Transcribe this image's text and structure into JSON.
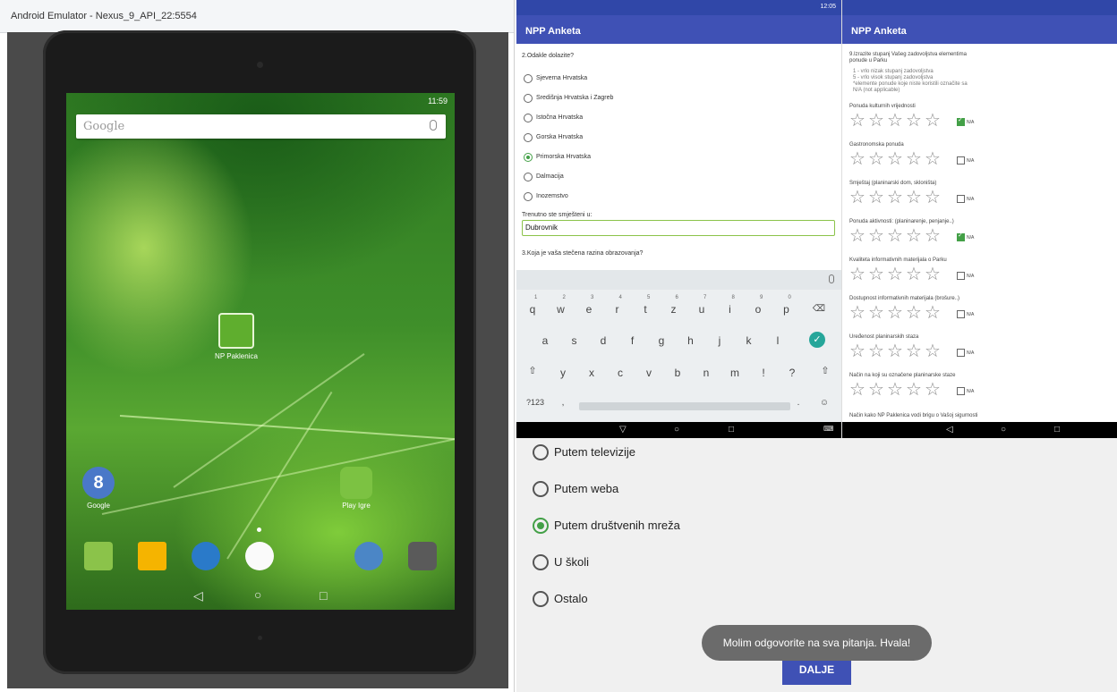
{
  "emulator": {
    "window_title": "Android Emulator - Nexus_9_API_22:5554",
    "status_time": "11:59",
    "search_label": "Google",
    "center_app": "NP Paklenica",
    "left_app": "Google",
    "right_app": "Play Igre"
  },
  "phone1": {
    "status_time": "12:05",
    "title": "NPP Anketa",
    "question": "2.Odakle dolazite?",
    "options": [
      "Sjeverna Hrvatska",
      "Središnja Hrvatska i Zagreb",
      "Istočna Hrvatska",
      "Gorska Hrvatska",
      "Primorska Hrvatska",
      "Dalmacija",
      "Inozemstvo"
    ],
    "selected_option": "Primorska Hrvatska",
    "stay_label": "Trenutno ste smješteni u:",
    "stay_value": "Dubrovnik",
    "question3": "3.Koja je vaša stečena razina obrazovanja?",
    "keyboard": {
      "row1": [
        "q",
        "w",
        "e",
        "r",
        "t",
        "z",
        "u",
        "i",
        "o",
        "p"
      ],
      "row1_hints": [
        "1",
        "2",
        "3",
        "4",
        "5",
        "6",
        "7",
        "8",
        "9",
        "0"
      ],
      "row2": [
        "a",
        "s",
        "d",
        "f",
        "g",
        "h",
        "j",
        "k",
        "l"
      ],
      "row3": [
        "y",
        "x",
        "c",
        "v",
        "b",
        "n",
        "m",
        "!",
        "?"
      ],
      "symbols": "?123",
      "comma": ",",
      "period": "."
    }
  },
  "phone2": {
    "title": "NPP Anketa",
    "question_line1": "9.Izrazite stupanj Vašeg zadovoljstva elementima",
    "question_line2": "ponude u Parku",
    "legend": [
      "1 - vrlo nizak stupanj zadovoljstva",
      "5 - vrlo visok stupanj zadovoljstva",
      "*elemente ponude koje niste koristili označite sa",
      "N/A (not applicable)"
    ],
    "na_label": "N/A",
    "items": [
      {
        "label": "Ponuda kulturnih vrijednosti",
        "na_checked": true
      },
      {
        "label": "Gastronomska ponuda",
        "na_checked": false
      },
      {
        "label": "Smještaj (planinarski dom, skloništa)",
        "na_checked": false
      },
      {
        "label": "Ponuda aktivnosti: (planinarenje, penjanje..)",
        "na_checked": true
      },
      {
        "label": "Kvaliteta informativnih materijala o Parku",
        "na_checked": false
      },
      {
        "label": "Dostupnost informativnih materijala (brošure..)",
        "na_checked": false
      },
      {
        "label": "Uređenost planinarskih staza",
        "na_checked": false
      },
      {
        "label": "Način na koji su označene planinarske staze",
        "na_checked": false
      }
    ],
    "cut_text": "Način kako NP Paklenica vodi brigu o Vašoj sigurnosti"
  },
  "bottom": {
    "options": [
      "Putem televizije",
      "Putem weba",
      "Putem društvenih mreža",
      "U školi",
      "Ostalo"
    ],
    "selected_option": "Putem društvenih mreža",
    "toast": "Molim odgovorite na sva pitanja. Hvala!",
    "next_button": "DALJE"
  }
}
